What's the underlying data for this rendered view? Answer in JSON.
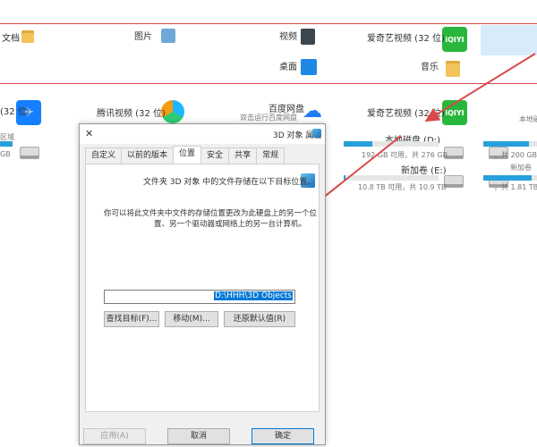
{
  "folders": {
    "col1": {
      "label": "文档"
    },
    "pictures": {
      "label": "图片"
    },
    "videos": {
      "label": "视频"
    },
    "music": {
      "label": "音乐"
    },
    "desktop": {
      "label": "桌面"
    },
    "iqiyi_app": {
      "label": "爱奇艺视频 (32 位)"
    }
  },
  "apps": {
    "iqiyi_mid": {
      "label": "爱奇艺视频 (32 位)",
      "logo": "iQIYI"
    },
    "tencent_video": {
      "label": "腾讯视频 (32 位)"
    },
    "baidu_netdisk": {
      "label": "百度网盘",
      "sublabel": "双击运行百度网盘"
    },
    "left_app": {
      "label": "(32 位)"
    }
  },
  "drives": {
    "local_disk": {
      "label": "本地磁盘 (D:)",
      "free_text": "192 GB 可用，共 276 GB",
      "fill_ratio": 0.3
    },
    "new_volume": {
      "label": "新加卷 (E:)",
      "free_text": "10.8 TB 可用，共 10.9 TB",
      "fill_ratio": 0.02
    },
    "right_top": {
      "label": "，共 200 GB",
      "fill_ratio": 0.85
    },
    "right_bottom": {
      "label": "，共 1.81 TB",
      "fill_ratio": 0.9
    },
    "right_top_label": {
      "label": "本地磁盘"
    },
    "right_bottom_label": {
      "label": "新加卷"
    },
    "left_drive_text": {
      "label": "GB"
    },
    "left_drive_sub": {
      "label": "区域"
    }
  },
  "dialog": {
    "title": "3D 对象 属性",
    "tabs": [
      "常规",
      "共享",
      "安全",
      "位置",
      "以前的版本",
      "自定义"
    ],
    "active_tab": "位置",
    "info_line": "文件夹 3D 对象 中的文件存储在以下目标位置。",
    "desc_line1": "你可以将此文件夹中文件的存储位置更改为此硬盘上的另一个位",
    "desc_line2": "置、另一个驱动器或网络上的另一台计算机。",
    "path_value": "D:\\HHH\\3D Objects",
    "buttons": {
      "restore": "还原默认值(R)",
      "move": "移动(M)...",
      "find": "查找目标(F)..."
    },
    "footer": {
      "ok": "确定",
      "cancel": "取消",
      "apply": "应用(A)"
    }
  },
  "colors": {
    "annotation_red": "#d84848",
    "accent_blue": "#0078d7",
    "progress_blue": "#26a0da"
  }
}
